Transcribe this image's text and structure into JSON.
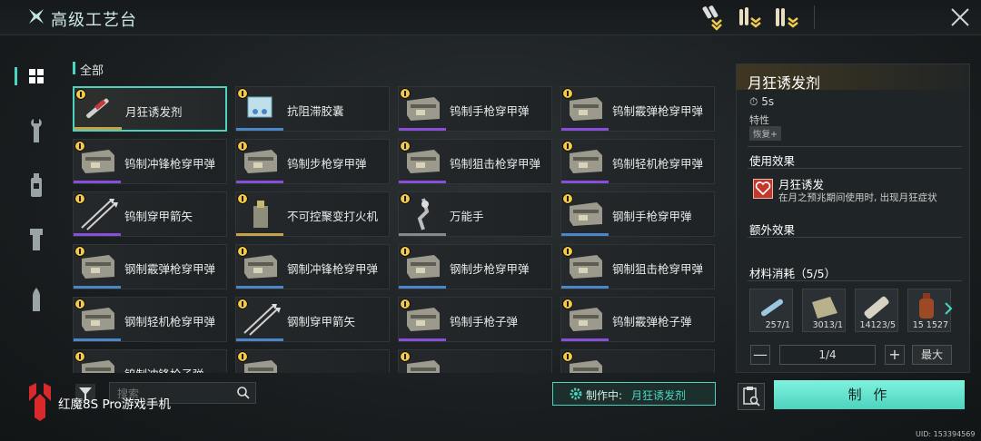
{
  "header": {
    "title": "高级工艺台"
  },
  "section_label": "全部",
  "items": [
    {
      "name": "月狂诱发剂",
      "selected": true,
      "thumb": "syringe",
      "bar": "#c8a24a"
    },
    {
      "name": "抗阻滞胶囊",
      "thumb": "pills",
      "bar": "#4a86c8"
    },
    {
      "name": "钨制手枪穿甲弹",
      "thumb": "ammo-box",
      "bar": "#8a4fd8"
    },
    {
      "name": "钨制霰弹枪穿甲弹",
      "thumb": "ammo-box",
      "bar": "#8a4fd8"
    },
    {
      "name": "钨制冲锋枪穿甲弹",
      "thumb": "ammo-box",
      "bar": "#8a4fd8"
    },
    {
      "name": "钨制步枪穿甲弹",
      "thumb": "ammo-box",
      "bar": "#8a4fd8"
    },
    {
      "name": "钨制狙击枪穿甲弹",
      "thumb": "ammo-box",
      "bar": "#8a4fd8"
    },
    {
      "name": "钨制轻机枪穿甲弹",
      "thumb": "ammo-box",
      "bar": "#8a4fd8"
    },
    {
      "name": "钨制穿甲箭矢",
      "thumb": "arrows",
      "bar": "#8a4fd8"
    },
    {
      "name": "不可控聚变打火机",
      "thumb": "lighter",
      "bar": "#c8a24a"
    },
    {
      "name": "万能手",
      "thumb": "hand",
      "bar": "#888888"
    },
    {
      "name": "钢制手枪穿甲弹",
      "thumb": "ammo-box",
      "bar": "#4a86c8"
    },
    {
      "name": "钢制霰弹枪穿甲弹",
      "thumb": "ammo-box",
      "bar": "#4a86c8"
    },
    {
      "name": "钢制冲锋枪穿甲弹",
      "thumb": "ammo-box",
      "bar": "#4a86c8"
    },
    {
      "name": "钢制步枪穿甲弹",
      "thumb": "ammo-box",
      "bar": "#4a86c8"
    },
    {
      "name": "钢制狙击枪穿甲弹",
      "thumb": "ammo-box",
      "bar": "#4a86c8"
    },
    {
      "name": "钢制轻机枪穿甲弹",
      "thumb": "ammo-box",
      "bar": "#4a86c8"
    },
    {
      "name": "钢制穿甲箭矢",
      "thumb": "arrows",
      "bar": "#4a86c8"
    },
    {
      "name": "钨制手枪子弹",
      "thumb": "ammo-box",
      "bar": "#8a4fd8"
    },
    {
      "name": "钨制霰弹枪子弹",
      "thumb": "ammo-box",
      "bar": "#8a4fd8"
    },
    {
      "name": "钨制冲锋枪子弹",
      "thumb": "ammo-box",
      "bar": "#8a4fd8"
    },
    {
      "name": "",
      "thumb": "ammo-box",
      "bar": "#8a4fd8"
    },
    {
      "name": "",
      "thumb": "ammo-box",
      "bar": "#8a4fd8"
    },
    {
      "name": "",
      "thumb": "ammo-box",
      "bar": "#8a4fd8"
    }
  ],
  "search": {
    "placeholder": "搜索"
  },
  "crafting_status": {
    "label": "制作中:",
    "item": "月狂诱发剂"
  },
  "brand": "红魔8S Pro游戏手机",
  "detail": {
    "title": "月狂诱发剂",
    "time": "5s",
    "attr_label": "特性",
    "tag": "恢复+",
    "use_effect_label": "使用效果",
    "effect_name": "月狂诱发",
    "effect_desc": "在月之预兆期间使用时, 出现月狂症状",
    "extra_effect_label": "额外效果",
    "materials_label": "材料消耗（5/5）",
    "materials": [
      {
        "count": "257/1",
        "icon": "vial-icon"
      },
      {
        "count": "3013/1",
        "icon": "cloth-icon"
      },
      {
        "count": "14123/5",
        "icon": "bandage-icon"
      },
      {
        "count": "15   1527",
        "icon": "bottle-icon"
      }
    ]
  },
  "quantity": {
    "value": "1/4",
    "max_label": "最大",
    "minus": "—",
    "plus": "+"
  },
  "make_button": "制 作",
  "uid": "UID: 153394569",
  "colors": {
    "accent": "#4ad6c3",
    "gold": "#f2c94c"
  }
}
